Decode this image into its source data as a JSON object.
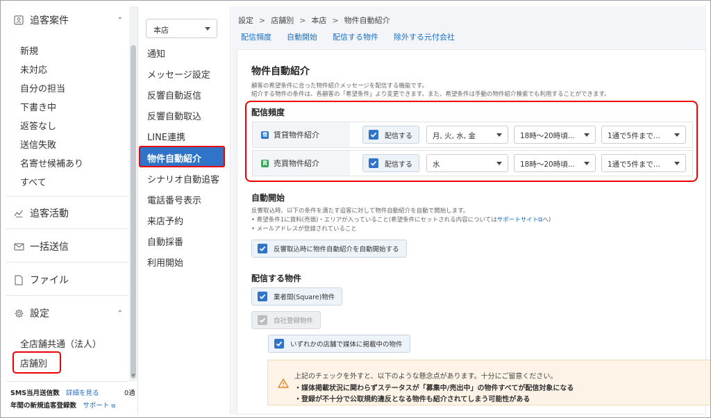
{
  "sidebar": {
    "sections": {
      "customers": {
        "label": "追客案件",
        "icon": "person-card-icon"
      },
      "activity": {
        "label": "追客活動",
        "icon": "activity-chart-icon"
      },
      "bulk": {
        "label": "一括送信",
        "icon": "mail-icon"
      },
      "file": {
        "label": "ファイル",
        "icon": "document-icon"
      },
      "settings": {
        "label": "設定",
        "icon": "gear-icon"
      }
    },
    "customer_items": [
      "新規",
      "未対応",
      "自分の担当",
      "下書き中",
      "返答なし",
      "送信失敗",
      "名寄せ候補あり",
      "すべて"
    ],
    "settings_items": [
      "全店舗共通（法人）",
      "店舗別"
    ],
    "footer": {
      "sms_label": "SMS当月送信数",
      "sms_link": "詳細を見る",
      "sms_count": "0通",
      "yearly_label": "年間の新規追客登録数",
      "yearly_link": "サポート"
    }
  },
  "subnav": {
    "store": "本店",
    "items": [
      "通知",
      "メッセージ設定",
      "反響自動返信",
      "反響自動取込",
      "LINE連携",
      "物件自動紹介",
      "シナリオ自動追客",
      "電話番号表示",
      "来店予約",
      "自動採番",
      "利用開始"
    ],
    "active": "物件自動紹介"
  },
  "main": {
    "breadcrumb": [
      "設定",
      "店舗別",
      "本店",
      "物件自動紹介"
    ],
    "tabs": [
      "配信頻度",
      "自動開始",
      "配信する物件",
      "除外する元付会社"
    ],
    "title": "物件自動紹介",
    "description_1": "顧客の希望条件に合った物件紹介メッセージを配信する機能です。",
    "description_2": "紹介する物件の条件は、各顧客の「希望条件」より変更できます。また、希望条件は手動の物件紹介検索でも利用することができます。",
    "frequency": {
      "heading": "配信頻度",
      "rows": [
        {
          "badge": "借",
          "badge_color": "#2f74c8",
          "label": "賃貸物件紹介",
          "check_label": "配信する",
          "days": "月, 火, 水, 金",
          "time": "18時～20時頃...",
          "count": "1通で5件まで..."
        },
        {
          "badge": "買",
          "badge_color": "#3aa55a",
          "label": "売買物件紹介",
          "check_label": "配信する",
          "days": "水",
          "time": "18時～20時頃...",
          "count": "1通で5件まで..."
        }
      ]
    },
    "auto_start": {
      "heading": "自動開始",
      "desc": "反響取込時、以下の条件を満たす追客に対して物件自動紹介を自動で開始します。",
      "bullet_1_pre": "希望条件1に賃料(売価)・エリアが入っていること(希望条件にセットされる内容については",
      "bullet_1_link": "サポートサイト",
      "bullet_1_post": "へ)",
      "bullet_2": "メールアドレスが登録されていること",
      "checkbox": "反響取込時に物件自動紹介を自動開始する"
    },
    "properties": {
      "heading": "配信する物件",
      "opt_square": "業者間(Square)物件",
      "opt_own": "自社登録物件",
      "opt_listed": "いずれかの店舗で媒体に掲載中の物件"
    },
    "warning": {
      "line1": "上記のチェックを外すと、以下のような懸念点があります。十分にご留意ください。",
      "line2": "・媒体掲載状況に関わらずステータスが「募集中/売出中」の物件すべてが配信対象になる",
      "line3": "・登録が不十分で公取規約違反となる物件も紹介されてしまう可能性がある",
      "icon": "warning-triangle-icon",
      "accent": "#e8851c"
    }
  }
}
